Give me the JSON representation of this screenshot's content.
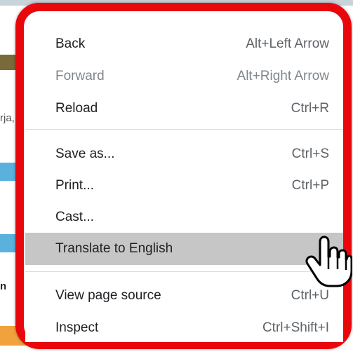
{
  "background": {
    "partial_text": "rja,",
    "partial_letter": "n"
  },
  "context_menu": {
    "items": [
      {
        "label": "Back",
        "shortcut": "Alt+Left Arrow"
      },
      {
        "label": "Forward",
        "shortcut": "Alt+Right Arrow",
        "disabled": true
      },
      {
        "label": "Reload",
        "shortcut": "Ctrl+R"
      },
      {
        "label": "Save as...",
        "shortcut": "Ctrl+S"
      },
      {
        "label": "Print...",
        "shortcut": "Ctrl+P"
      },
      {
        "label": "Cast...",
        "shortcut": ""
      },
      {
        "label": "Translate to English",
        "shortcut": "",
        "highlighted": true
      },
      {
        "label": "View page source",
        "shortcut": "Ctrl+U"
      },
      {
        "label": "Inspect",
        "shortcut": "Ctrl+Shift+I"
      }
    ]
  },
  "colors": {
    "highlight_frame": "#e8080c",
    "hover_row": "#c6c6c6"
  },
  "icons": {
    "cursor": "hand-pointer-icon"
  }
}
